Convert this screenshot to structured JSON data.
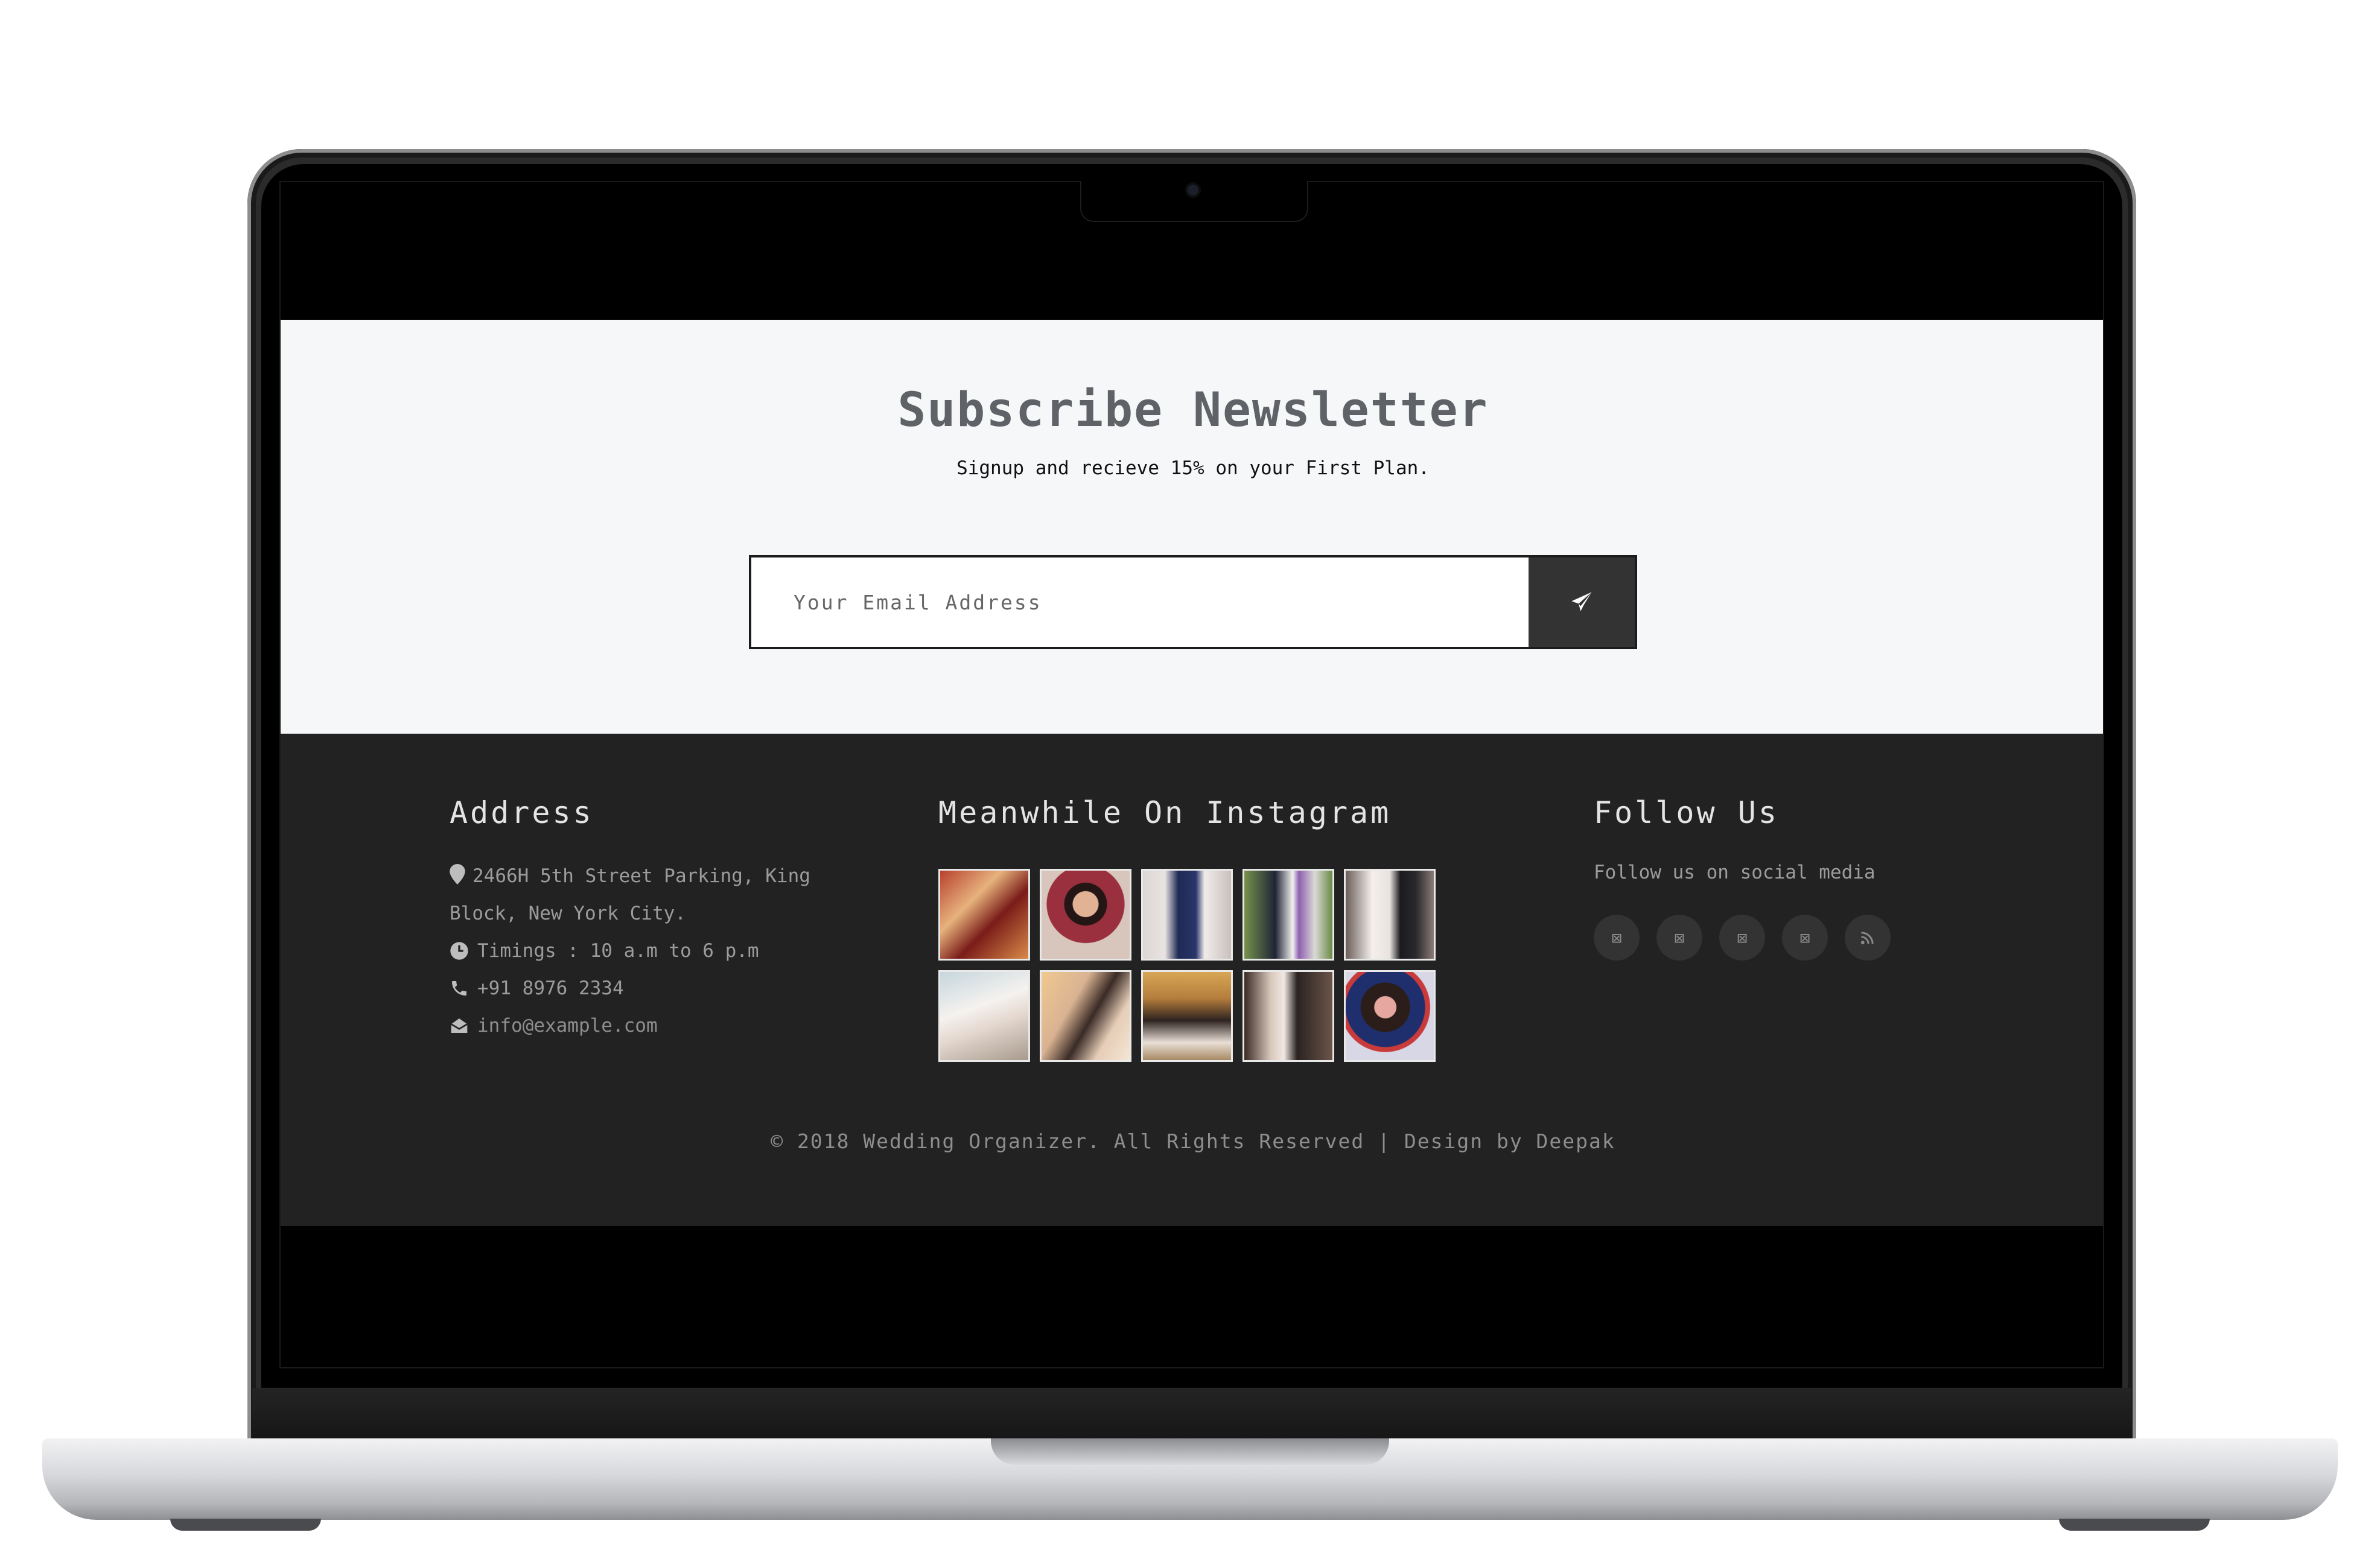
{
  "newsletter": {
    "title": "Subscribe Newsletter",
    "subtitle": "Signup and recieve 15% on your First Plan.",
    "email_placeholder": "Your Email Address",
    "submit_icon": "paper-plane-icon"
  },
  "footer": {
    "address": {
      "title": "Address",
      "street": "2466H 5th Street Parking, King Block, New York City.",
      "timings": "Timings : 10 a.m to 6 p.m",
      "phone": "+91 8976 2334",
      "email": "info@example.com"
    },
    "instagram": {
      "title": "Meanwhile On Instagram",
      "photos": [
        "couple-photo-1",
        "couple-photo-2",
        "couple-photo-3",
        "couple-photo-4",
        "couple-photo-5",
        "couple-photo-6",
        "couple-photo-7",
        "couple-photo-8",
        "couple-photo-9",
        "couple-photo-10"
      ]
    },
    "follow": {
      "title": "Follow Us",
      "text": "Follow us on social media",
      "icons": [
        "facebook-icon",
        "twitter-icon",
        "google-plus-icon",
        "linkedin-icon",
        "rss-icon"
      ],
      "icon_glyph": "⊠"
    },
    "copyright": "© 2018 Wedding Organizer. All Rights Reserved | Design by Deepak"
  },
  "colors": {
    "newsletter_bg": "#f6f7f9",
    "footer_bg": "#222222",
    "button_bg": "#333333"
  }
}
